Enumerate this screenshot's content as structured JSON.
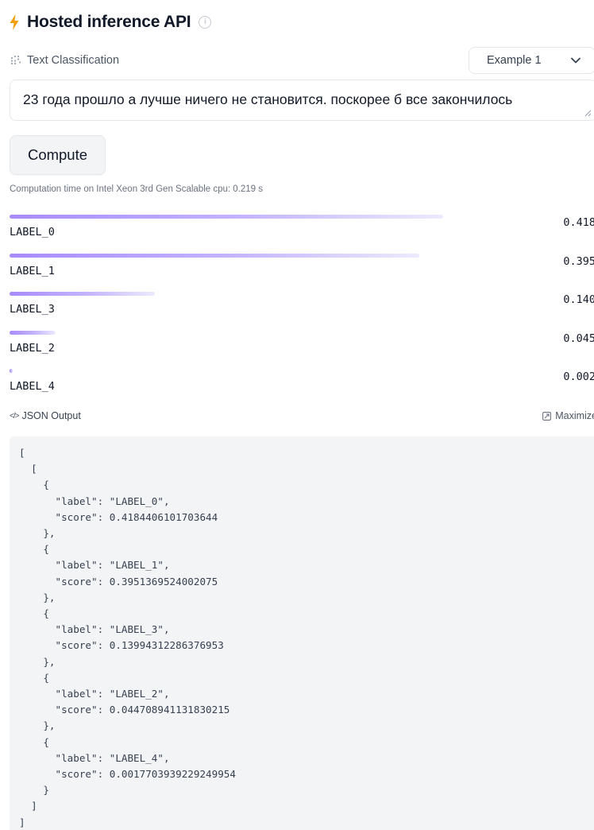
{
  "header": {
    "title": "Hosted inference API",
    "bolt_icon": "lightning-bolt-icon",
    "info_icon": "info-icon",
    "accent": "#f59e0b"
  },
  "task": {
    "label": "Text Classification",
    "example_select": "Example 1"
  },
  "input": {
    "value": "23 года прошло а лучше ничего не становится. поскорее б все закончилось"
  },
  "compute": {
    "button_label": "Compute",
    "time_text": "Computation time on Intel Xeon 3rd Gen Scalable cpu: 0.219 s"
  },
  "results": [
    {
      "label": "LABEL_0",
      "score_text": "0.418",
      "score": 0.4184406101703644
    },
    {
      "label": "LABEL_1",
      "score_text": "0.395",
      "score": 0.3951369524002075
    },
    {
      "label": "LABEL_3",
      "score_text": "0.140",
      "score": 0.13994312286376953
    },
    {
      "label": "LABEL_2",
      "score_text": "0.045",
      "score": 0.044708941131830215
    },
    {
      "label": "LABEL_4",
      "score_text": "0.002",
      "score": 0.0017703939229249954
    }
  ],
  "json_output": {
    "title": "JSON Output",
    "maximize_label": "Maximize",
    "code": "[\n  [\n    {\n      \"label\": \"LABEL_0\",\n      \"score\": 0.4184406101703644\n    },\n    {\n      \"label\": \"LABEL_1\",\n      \"score\": 0.3951369524002075\n    },\n    {\n      \"label\": \"LABEL_3\",\n      \"score\": 0.13994312286376953\n    },\n    {\n      \"label\": \"LABEL_2\",\n      \"score\": 0.044708941131830215\n    },\n    {\n      \"label\": \"LABEL_4\",\n      \"score\": 0.0017703939229249954\n    }\n  ]\n]"
  },
  "colors": {
    "bar_start": "#a78bfa",
    "bar_end": "#ede9fe",
    "json_bg": "#f3f4f6"
  }
}
